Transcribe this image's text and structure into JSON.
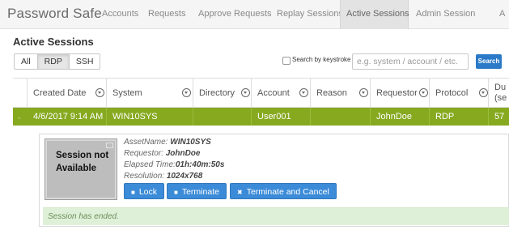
{
  "app": {
    "title": "Password Safe"
  },
  "nav": {
    "tabs": [
      {
        "label": "Accounts"
      },
      {
        "label": "Requests"
      },
      {
        "label": "Approve Requests"
      },
      {
        "label": "Replay Sessions"
      },
      {
        "label": "Active Sessions",
        "active": true
      },
      {
        "label": "Admin Session"
      },
      {
        "label": "A"
      }
    ]
  },
  "page": {
    "title": "Active Sessions"
  },
  "filters": {
    "buttons": [
      {
        "label": "All"
      },
      {
        "label": "RDP",
        "active": true
      },
      {
        "label": "SSH"
      }
    ]
  },
  "search": {
    "checkbox_label": "Search by keystroke",
    "checked": false,
    "placeholder": "e.g. system / account / etc.",
    "button_label": "Search"
  },
  "table": {
    "columns": [
      {
        "label": "Created Date"
      },
      {
        "label": "System"
      },
      {
        "label": "Directory"
      },
      {
        "label": "Account"
      },
      {
        "label": "Reason"
      },
      {
        "label": "Requestor"
      },
      {
        "label": "Protocol"
      },
      {
        "label": "Du (se"
      }
    ],
    "rows": [
      {
        "created_date": "4/6/2017 9:14 AM",
        "system": "WIN10SYS",
        "directory": "",
        "account": "User001",
        "reason": "",
        "requestor": "JohnDoe",
        "protocol": "RDP",
        "duration": "57",
        "selected": true
      }
    ]
  },
  "detail": {
    "thumbnail_text": "Session not Available",
    "asset_name_label": "AssetName:",
    "asset_name": "WIN10SYS",
    "requestor_label": "Requestor:",
    "requestor": "JohnDoe",
    "elapsed_label": "Elapsed Time:",
    "elapsed": "01h:40m:50s",
    "resolution_label": "Resolution:",
    "resolution": "1024x768",
    "actions": {
      "lock": "Lock",
      "terminate": "Terminate",
      "terminate_cancel": "Terminate and Cancel"
    },
    "status_message": "Session has ended."
  },
  "colors": {
    "selected_row": "#86a920",
    "primary_button": "#3b8bd8",
    "alert_success_bg": "#dff0d8"
  }
}
